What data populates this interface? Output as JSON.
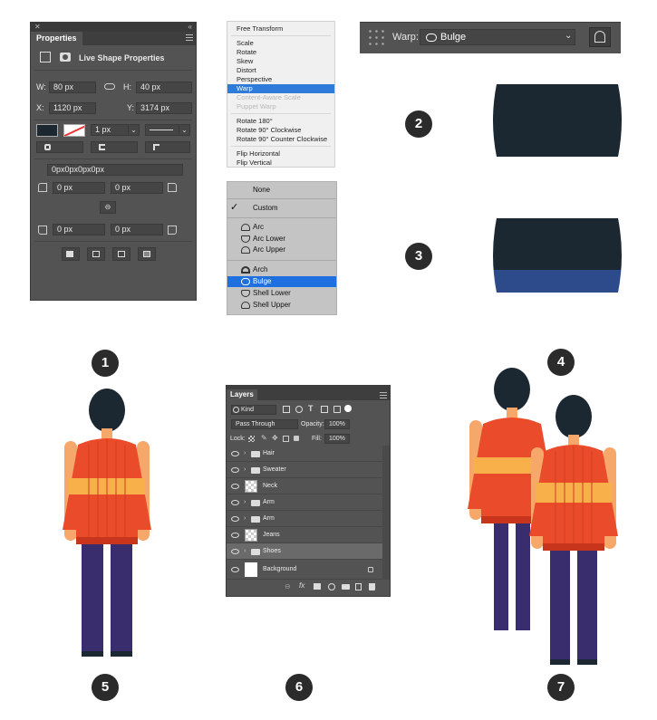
{
  "properties_panel": {
    "tab": "Properties",
    "heading": "Live Shape Properties",
    "w_label": "W:",
    "w_value": "80 px",
    "h_label": "H:",
    "h_value": "40 px",
    "x_label": "X:",
    "x_value": "1120 px",
    "y_label": "Y:",
    "y_value": "3174 px",
    "stroke_width": "1 px",
    "corner_all": "0px0px0px0px",
    "corner_tl": "0 px",
    "corner_tr": "0 px",
    "corner_bl": "0 px",
    "corner_br": "0 px"
  },
  "context_menu": {
    "items": [
      "Free Transform",
      "Scale",
      "Rotate",
      "Skew",
      "Distort",
      "Perspective",
      "Warp",
      "Content-Aware Scale",
      "Puppet Warp",
      "Rotate 180°",
      "Rotate 90° Clockwise",
      "Rotate 90° Counter Clockwise",
      "Flip Horizontal",
      "Flip Vertical"
    ],
    "highlighted": "Warp",
    "disabled": [
      "Content-Aware Scale",
      "Puppet Warp"
    ]
  },
  "warp_list": {
    "items": [
      "None",
      "Custom",
      "Arc",
      "Arc Lower",
      "Arc Upper",
      "Arch",
      "Bulge",
      "Shell Lower",
      "Shell Upper"
    ],
    "checked": "Custom",
    "highlighted": "Bulge"
  },
  "warp_bar": {
    "label": "Warp:",
    "value": "Bulge"
  },
  "badges": [
    "1",
    "2",
    "3",
    "4",
    "5",
    "6",
    "7"
  ],
  "layers_panel": {
    "tab": "Layers",
    "filter": "Kind",
    "blend_mode": "Pass Through",
    "opacity_label": "Opacity:",
    "opacity_value": "100%",
    "lock_label": "Lock:",
    "fill_label": "Fill:",
    "fill_value": "100%",
    "layers": [
      "Hair",
      "Sweater",
      "Neck",
      "Arm",
      "Arm",
      "Jeans",
      "Shoes",
      "Background"
    ]
  },
  "colors": {
    "panel_bg": "#535353",
    "shape_dark": "#1b2831",
    "shape_blue": "#2d4b8a",
    "sweater": "#ea4b2a",
    "stripe": "#f8b04a",
    "jeans": "#3a2d6e",
    "hair": "#1b2831",
    "skin": "#f6a76a",
    "highlight": "#2f7bd9"
  }
}
